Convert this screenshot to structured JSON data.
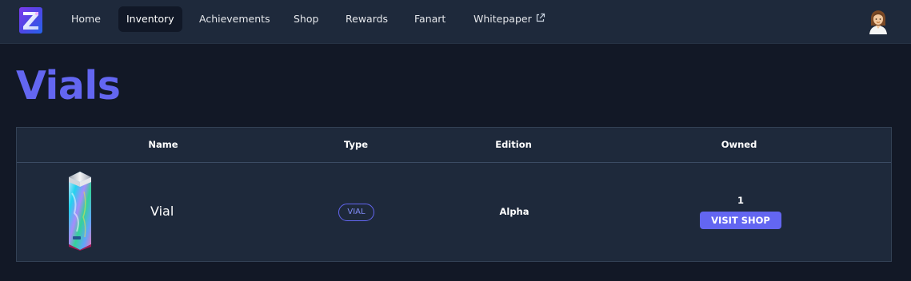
{
  "nav": {
    "logo_icon": "z-logo-icon",
    "items": [
      {
        "label": "Home"
      },
      {
        "label": "Inventory",
        "active": true
      },
      {
        "label": "Achievements"
      },
      {
        "label": "Shop"
      },
      {
        "label": "Rewards"
      },
      {
        "label": "Fanart"
      },
      {
        "label": "Whitepaper",
        "icon": "external-link-icon"
      }
    ],
    "avatar_icon": "user-avatar-icon"
  },
  "page": {
    "title": "Vials"
  },
  "table": {
    "columns": [
      "Name",
      "Type",
      "Edition",
      "Owned"
    ],
    "rows": [
      {
        "image_icon": "vial-image",
        "name": "Vial",
        "type": "VIAL",
        "edition": "Alpha",
        "owned": "1",
        "action_label": "VISIT SHOP"
      }
    ]
  },
  "colors": {
    "accent": "#6366f1",
    "nav_bg": "#1e293b",
    "page_bg": "#121826",
    "table_bg": "#1e293b"
  }
}
